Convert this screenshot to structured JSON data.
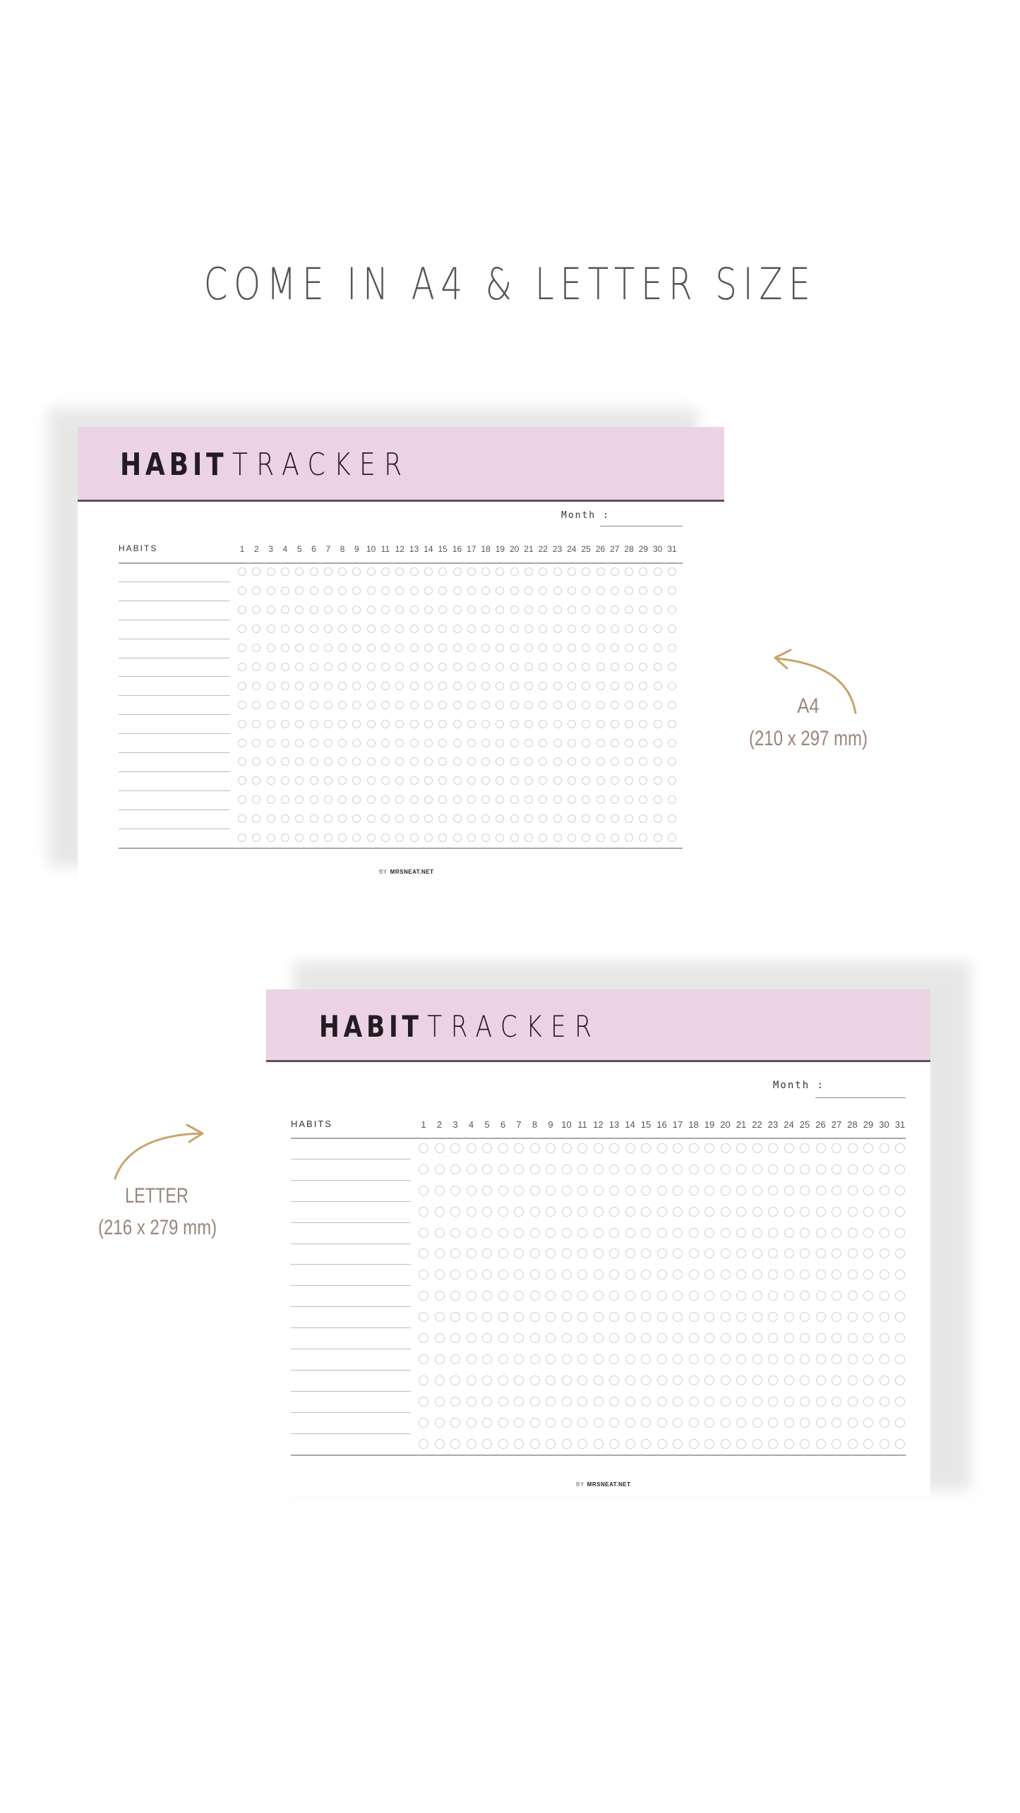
{
  "headline": "COME IN A4 & LETTER SIZE",
  "colors": {
    "banner": "#ecd3e4",
    "rule": "#5e5258",
    "annotation": "#9a857c",
    "arrow": "#c8a46a"
  },
  "trackers": [
    {
      "id": "a4",
      "title_bold": "HABIT",
      "title_light": "TRACKER",
      "month_label": "Month :",
      "habits_label": "HABITS",
      "days": [
        1,
        2,
        3,
        4,
        5,
        6,
        7,
        8,
        9,
        10,
        11,
        12,
        13,
        14,
        15,
        16,
        17,
        18,
        19,
        20,
        21,
        22,
        23,
        24,
        25,
        26,
        27,
        28,
        29,
        30,
        31
      ],
      "rows": 15,
      "footer_by": "BY",
      "footer_site": "MRSNEAT.NET"
    },
    {
      "id": "letter",
      "title_bold": "HABIT",
      "title_light": "TRACKER",
      "month_label": "Month :",
      "habits_label": "HABITS",
      "days": [
        1,
        2,
        3,
        4,
        5,
        6,
        7,
        8,
        9,
        10,
        11,
        12,
        13,
        14,
        15,
        16,
        17,
        18,
        19,
        20,
        21,
        22,
        23,
        24,
        25,
        26,
        27,
        28,
        29,
        30,
        31
      ],
      "rows": 15,
      "footer_by": "BY",
      "footer_site": "MRSNEAT.NET"
    }
  ],
  "annotations": {
    "a4": {
      "label": "A4",
      "dims": "(210 x 297 mm)",
      "icon": "curved-arrow-left-icon"
    },
    "letter": {
      "label": "LETTER",
      "dims": "(216 x 279 mm)",
      "icon": "curved-arrow-right-icon"
    }
  }
}
